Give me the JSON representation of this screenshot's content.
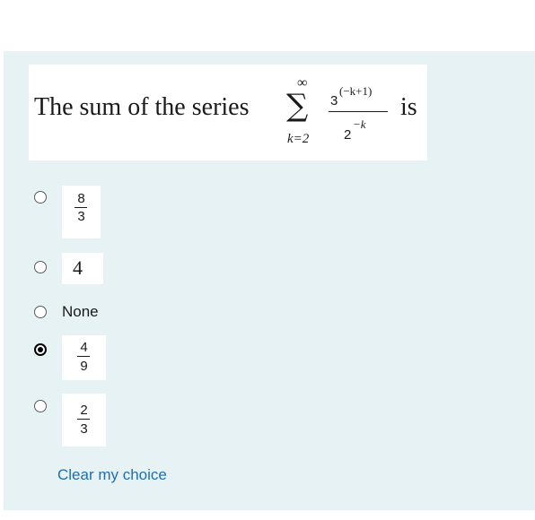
{
  "question": {
    "text": "The sum of the series",
    "suffix": "is",
    "sum_upper": "∞",
    "sum_symbol": "∑",
    "sum_lower": "k=2",
    "numerator_base": "3",
    "numerator_exponent": "(−k+1)",
    "denominator_base": "2",
    "denominator_exponent": "−k"
  },
  "options": [
    {
      "id": "opt-1",
      "type": "fraction",
      "numerator": "8",
      "denominator": "3",
      "selected": false
    },
    {
      "id": "opt-2",
      "type": "text",
      "label": "4",
      "selected": false
    },
    {
      "id": "opt-3",
      "type": "text",
      "label": "None",
      "selected": false
    },
    {
      "id": "opt-4",
      "type": "fraction",
      "numerator": "4",
      "denominator": "9",
      "selected": true
    },
    {
      "id": "opt-5",
      "type": "fraction",
      "numerator": "2",
      "denominator": "3",
      "selected": false
    }
  ],
  "clear_choice_label": "Clear my choice",
  "colors": {
    "panel_bg": "#e7f2f5",
    "link": "#1f6fb0"
  }
}
